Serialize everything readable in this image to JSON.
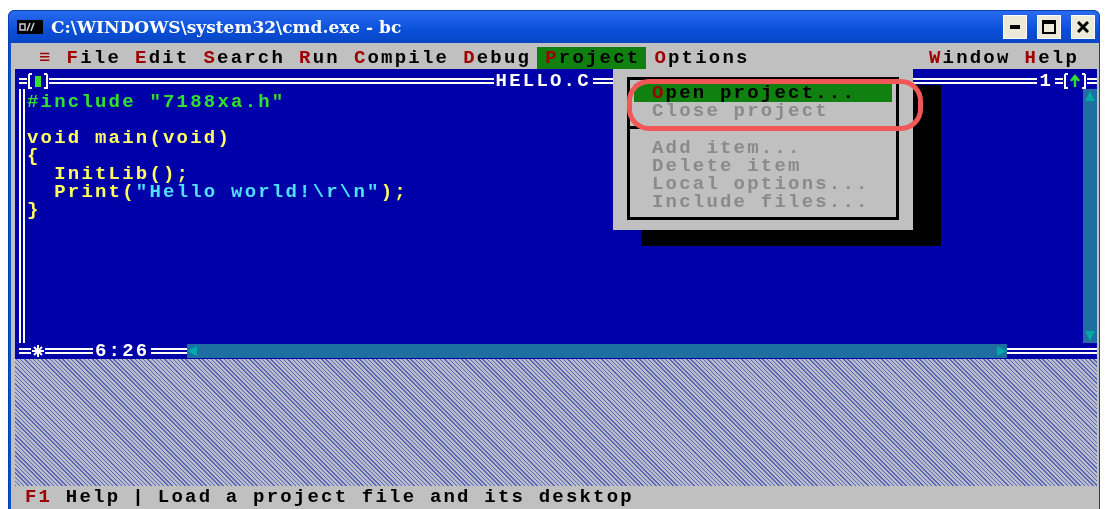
{
  "window": {
    "title": "C:\\WINDOWS\\system32\\cmd.exe - bc"
  },
  "menu_left": [
    {
      "label": "≡",
      "selected": false
    },
    {
      "label": "File",
      "selected": false
    },
    {
      "label": "Edit",
      "selected": false
    },
    {
      "label": "Search",
      "selected": false
    },
    {
      "label": "Run",
      "selected": false
    },
    {
      "label": "Compile",
      "selected": false
    },
    {
      "label": "Debug",
      "selected": false
    },
    {
      "label": "Project",
      "selected": true
    },
    {
      "label": "Options",
      "selected": false
    }
  ],
  "menu_right": [
    {
      "label": "Window",
      "selected": false
    },
    {
      "label": "Help",
      "selected": false
    }
  ],
  "editor": {
    "title": "HELLO.C",
    "window_number": "1",
    "cursor": "6:26",
    "blocks": [
      [
        [
          {
            "text": "#include \"7188xa.h\"",
            "kind": "directive"
          }
        ]
      ],
      [
        [
          {
            "text": "void main(void)",
            "kind": "plain"
          }
        ],
        [
          {
            "text": "{",
            "kind": "plain"
          }
        ],
        [
          {
            "text": "  InitLib();",
            "kind": "call"
          }
        ],
        [
          {
            "text": "  Print(",
            "kind": "call"
          },
          {
            "text": "\"Hello world!\\r\\n\"",
            "kind": "string"
          },
          {
            "text": ");",
            "kind": "call"
          }
        ],
        [
          {
            "text": "}",
            "kind": "plain"
          }
        ]
      ]
    ]
  },
  "project_menu": {
    "groups": [
      [
        {
          "label": "Open project...",
          "selected": true,
          "disabled": false
        },
        {
          "label": "Close project",
          "selected": false,
          "disabled": true
        }
      ],
      [
        {
          "label": "Add item...",
          "selected": false,
          "disabled": true
        },
        {
          "label": "Delete item",
          "selected": false,
          "disabled": true
        },
        {
          "label": "Local options...",
          "selected": false,
          "disabled": true
        },
        {
          "label": "Include files...",
          "selected": false,
          "disabled": true
        }
      ]
    ]
  },
  "status_bar": {
    "key": "F1",
    "key_label": "Help",
    "divider": "|",
    "message": "Load a project file and its desktop"
  }
}
